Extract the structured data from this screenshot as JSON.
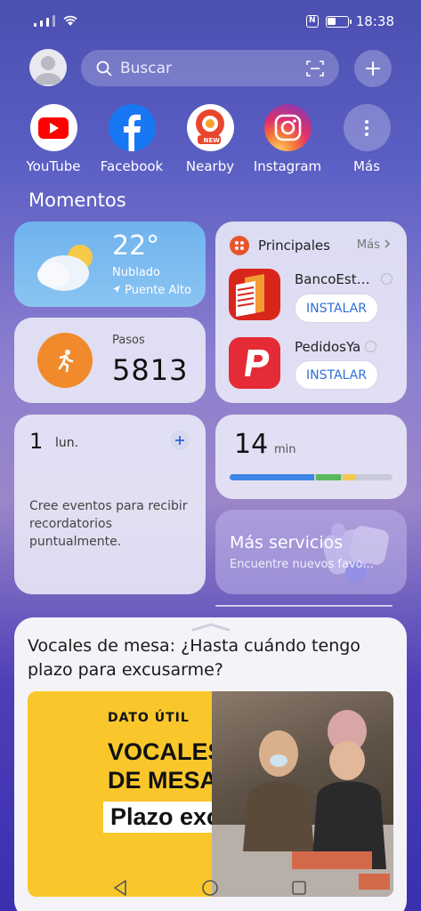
{
  "status_bar": {
    "time": "18:38",
    "battery_percent": 45
  },
  "header": {
    "search_placeholder": "Buscar"
  },
  "apps": [
    {
      "label": "YouTube",
      "icon": "youtube-icon"
    },
    {
      "label": "Facebook",
      "icon": "facebook-icon"
    },
    {
      "label": "Nearby",
      "icon": "nearby-icon",
      "badge": "NEW"
    },
    {
      "label": "Instagram",
      "icon": "instagram-icon"
    },
    {
      "label": "Más",
      "icon": "more-vertical-icon"
    }
  ],
  "section_title": "Momentos",
  "weather": {
    "temperature": "22°",
    "condition": "Nublado",
    "location": "Puente Alto"
  },
  "steps": {
    "label": "Pasos",
    "value": "5813"
  },
  "principales": {
    "title": "Principales",
    "more": "Más",
    "items": [
      {
        "name": "BancoEst…",
        "button": "INSTALAR"
      },
      {
        "name": "PedidosYa",
        "button": "INSTALAR"
      }
    ]
  },
  "calendar": {
    "day": "1",
    "weekday": "lun.",
    "message": "Cree eventos para recibir recordatorios puntualmente."
  },
  "screen_time": {
    "value": "14",
    "unit": "min",
    "segments": [
      {
        "fraction": 0.52,
        "color": "#3d86e6"
      },
      {
        "fraction": 0.15,
        "color": "#5bb85b"
      },
      {
        "fraction": 0.08,
        "color": "#f2c94c"
      }
    ]
  },
  "services": {
    "title": "Más servicios",
    "subtitle": "Encuentre nuevos favo..."
  },
  "news": {
    "title": "Vocales de mesa: ¿Hasta cuándo tengo plazo para excusarme?",
    "image_tag": "DATO ÚTIL",
    "headline_line1": "VOCALES",
    "headline_line2": "DE MESA",
    "headline_pill": "Plazo excusas"
  },
  "colors": {
    "accent_blue": "#2e6fd8",
    "steps_orange": "#f08a2b"
  }
}
